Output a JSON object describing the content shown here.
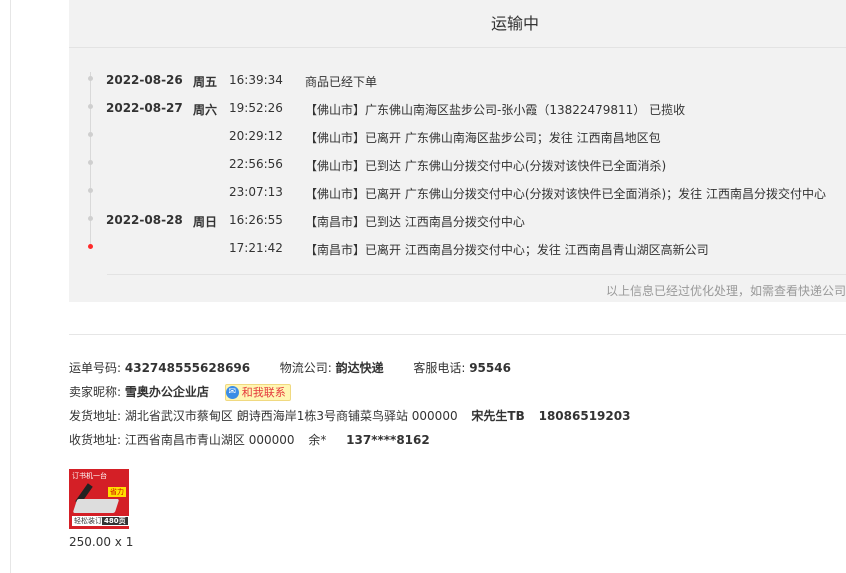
{
  "panel": {
    "title": "运输中",
    "note": "以上信息已经过优化处理，如需查看快递公司"
  },
  "timeline": [
    {
      "date": "2022-08-26",
      "weekday": "周五",
      "time": "16:39:34",
      "desc": "商品已经下单",
      "active": false
    },
    {
      "date": "2022-08-27",
      "weekday": "周六",
      "time": "19:52:26",
      "desc": "【佛山市】广东佛山南海区盐步公司-张小霞（13822479811） 已揽收",
      "active": false
    },
    {
      "date": "",
      "weekday": "",
      "time": "20:29:12",
      "desc": "【佛山市】已离开 广东佛山南海区盐步公司；发往 江西南昌地区包",
      "active": false
    },
    {
      "date": "",
      "weekday": "",
      "time": "22:56:56",
      "desc": "【佛山市】已到达 广东佛山分拨交付中心(分拨对该快件已全面消杀)",
      "active": false
    },
    {
      "date": "",
      "weekday": "",
      "time": "23:07:13",
      "desc": "【佛山市】已离开 广东佛山分拨交付中心(分拨对该快件已全面消杀)；发往 江西南昌分拨交付中心",
      "active": false
    },
    {
      "date": "2022-08-28",
      "weekday": "周日",
      "time": "16:26:55",
      "desc": "【南昌市】已到达 江西南昌分拨交付中心",
      "active": false
    },
    {
      "date": "",
      "weekday": "",
      "time": "17:21:42",
      "desc": "【南昌市】已离开 江西南昌分拨交付中心；发往 江西南昌青山湖区高新公司",
      "active": true
    }
  ],
  "info": {
    "waybill_label": "运单号码:",
    "waybill_value": "432748555628696",
    "courier_label": "物流公司:",
    "courier_value": "韵达快递",
    "service_label": "客服电话:",
    "service_value": "95546",
    "seller_label": "卖家昵称:",
    "seller_value": "雪奥办公企业店",
    "contact_label": "和我联系",
    "ship_label": "发货地址:",
    "ship_address": "湖北省武汉市蔡甸区 朗诗西海岸1栋3号商铺菜鸟驿站 000000",
    "ship_contact": "宋先生TB",
    "ship_phone": "18086519203",
    "recv_label": "收货地址:",
    "recv_address": "江西省南昌市青山湖区 000000",
    "recv_name": "余*",
    "recv_phone": "137****8162"
  },
  "product": {
    "thumb_title": "订书机一台",
    "thumb_badge": "省力",
    "thumb_caption": "轻松装订",
    "thumb_count": "480页",
    "price_qty": "250.00 x 1"
  }
}
